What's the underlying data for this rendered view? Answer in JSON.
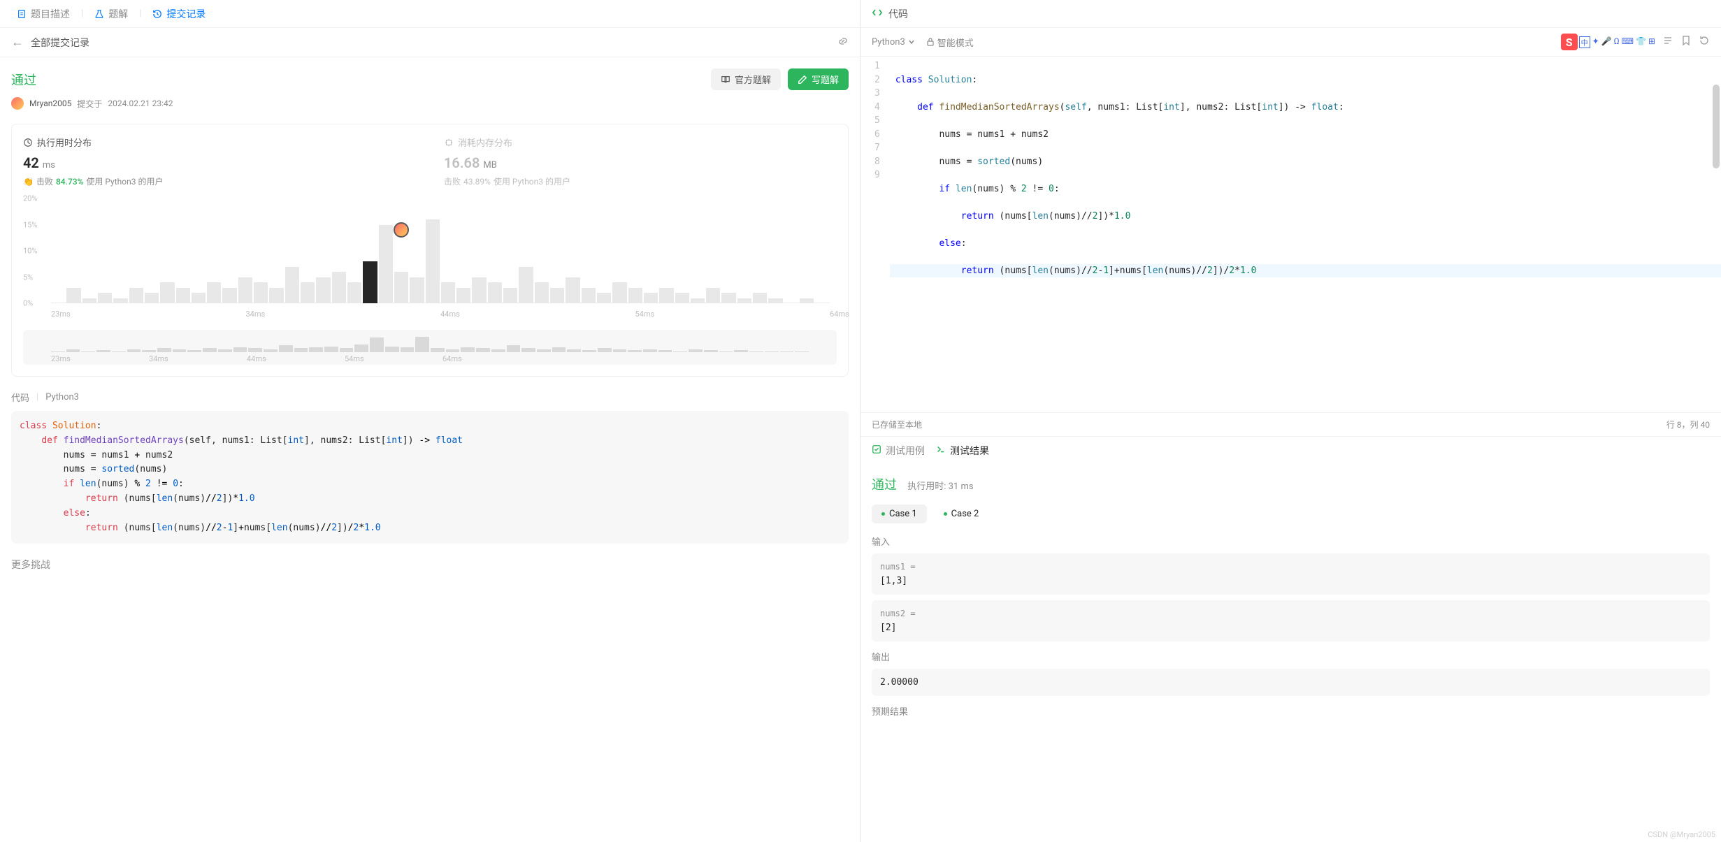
{
  "leftTabs": {
    "desc": "题目描述",
    "solution": "题解",
    "submissions": "提交记录"
  },
  "subHeader": {
    "title": "全部提交记录"
  },
  "status": {
    "pass": "通过",
    "officialBtn": "官方题解",
    "writeBtn": "写题解"
  },
  "meta": {
    "user": "Mryan2005",
    "submitLabel": "提交于",
    "time": "2024.02.21 23:42"
  },
  "stats": {
    "runtime": {
      "title": "执行用时分布",
      "value": "42",
      "unit": "ms",
      "beatPrefix": "击败",
      "beatPct": "84.73%",
      "beatSuffix": "使用 Python3 的用户"
    },
    "memory": {
      "title": "消耗内存分布",
      "value": "16.68",
      "unit": "MB",
      "beatPrefix": "击败",
      "beatPct": "43.89%",
      "beatSuffix": "使用 Python3 的用户"
    }
  },
  "chart_data": {
    "type": "bar",
    "ylabels": [
      "20%",
      "15%",
      "10%",
      "5%",
      "0%"
    ],
    "xlabels": [
      "23ms",
      "34ms",
      "44ms",
      "54ms",
      "64ms"
    ],
    "values": [
      0,
      3,
      1,
      2,
      1,
      3,
      2,
      4,
      3,
      2,
      4,
      3,
      5,
      4,
      3,
      7,
      4,
      5,
      6,
      4,
      8,
      15,
      6,
      5,
      16,
      4,
      3,
      5,
      4,
      3,
      7,
      4,
      3,
      5,
      3,
      2,
      4,
      3,
      2,
      3,
      2,
      1,
      3,
      2,
      1,
      2,
      1,
      0,
      1,
      0
    ],
    "highlight_index": 20,
    "marker_left_pct": 43,
    "marker_top_pct": 25
  },
  "codeSection": {
    "label": "代码",
    "lang": "Python3"
  },
  "moreTitle": "更多挑战",
  "rightHeader": {
    "title": "代码"
  },
  "langBar": {
    "lang": "Python3",
    "mode": "智能模式"
  },
  "editorStatus": {
    "saved": "已存储至本地",
    "cursor": "行 8，列 40"
  },
  "editorLines": [
    "1",
    "2",
    "3",
    "4",
    "5",
    "6",
    "7",
    "8",
    "9"
  ],
  "resultsTabs": {
    "testcase": "测试用例",
    "result": "测试结果"
  },
  "results": {
    "pass": "通过",
    "timeLabel": "执行用时:",
    "timeValue": "31 ms"
  },
  "cases": {
    "c1": "Case 1",
    "c2": "Case 2"
  },
  "io": {
    "inputLabel": "输入",
    "nums1Label": "nums1 =",
    "nums1Val": "[1,3]",
    "nums2Label": "nums2 =",
    "nums2Val": "[2]",
    "outputLabel": "输出",
    "outputVal": "2.00000",
    "expectedLabel": "预期结果"
  },
  "watermark": "CSDN @Mryan2005"
}
